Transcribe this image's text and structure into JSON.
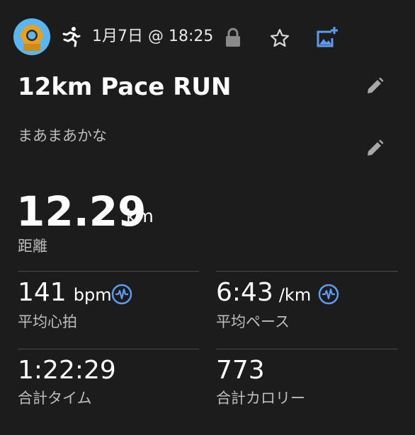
{
  "header": {
    "datetime": "1月7日 @ 18:25",
    "avatar_icon": "diving-helmet-icon",
    "activity_icon": "running-person-icon",
    "lock_icon": "lock-icon",
    "star_icon": "star-outline-icon",
    "add_photo_icon": "add-photo-icon",
    "accent_color": "#5b9bf0"
  },
  "activity": {
    "title": "12km Pace RUN",
    "description": "まあまあかな"
  },
  "distance": {
    "value": "12.29",
    "unit": "km",
    "label": "距離"
  },
  "stats": {
    "heart_rate": {
      "value": "141",
      "unit": "bpm",
      "label": "平均心拍"
    },
    "pace": {
      "value": "6:43",
      "unit": "/km",
      "label": "平均ペース"
    },
    "time": {
      "value": "1:22:29",
      "label": "合計タイム"
    },
    "calories": {
      "value": "773",
      "label": "合計カロリー"
    }
  }
}
